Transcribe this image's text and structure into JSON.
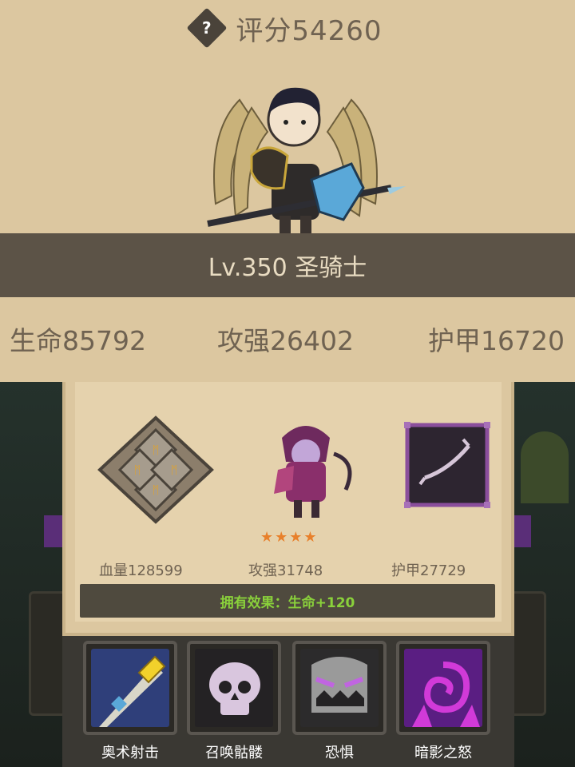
{
  "header": {
    "score": "评分54260",
    "level_class": "Lv.350 圣骑士"
  },
  "stats": {
    "hp": "生命85792",
    "attack": "攻强26402",
    "armor": "护甲16720"
  },
  "equipment": {
    "items": [
      {
        "icon": "rune-medallion-icon",
        "value": "血量128599"
      },
      {
        "icon": "dark-ranger-pet-icon",
        "value": "攻强31748",
        "stars": 4
      },
      {
        "icon": "dark-bow-icon",
        "value": "护甲27729"
      }
    ],
    "effect": "拥有效果：生命+120"
  },
  "skills": [
    {
      "icon": "arcane-shot-icon",
      "label": "奥术射击"
    },
    {
      "icon": "summon-skeleton-icon",
      "label": "召唤骷髅"
    },
    {
      "icon": "fear-icon",
      "label": "恐惧"
    },
    {
      "icon": "shadow-wrath-icon",
      "label": "暗影之怒"
    }
  ],
  "colors": {
    "panel_bg": "#dcc7a0",
    "band_bg": "#5c5347",
    "effect_text": "#8ad13b",
    "star": "#e8802b"
  }
}
